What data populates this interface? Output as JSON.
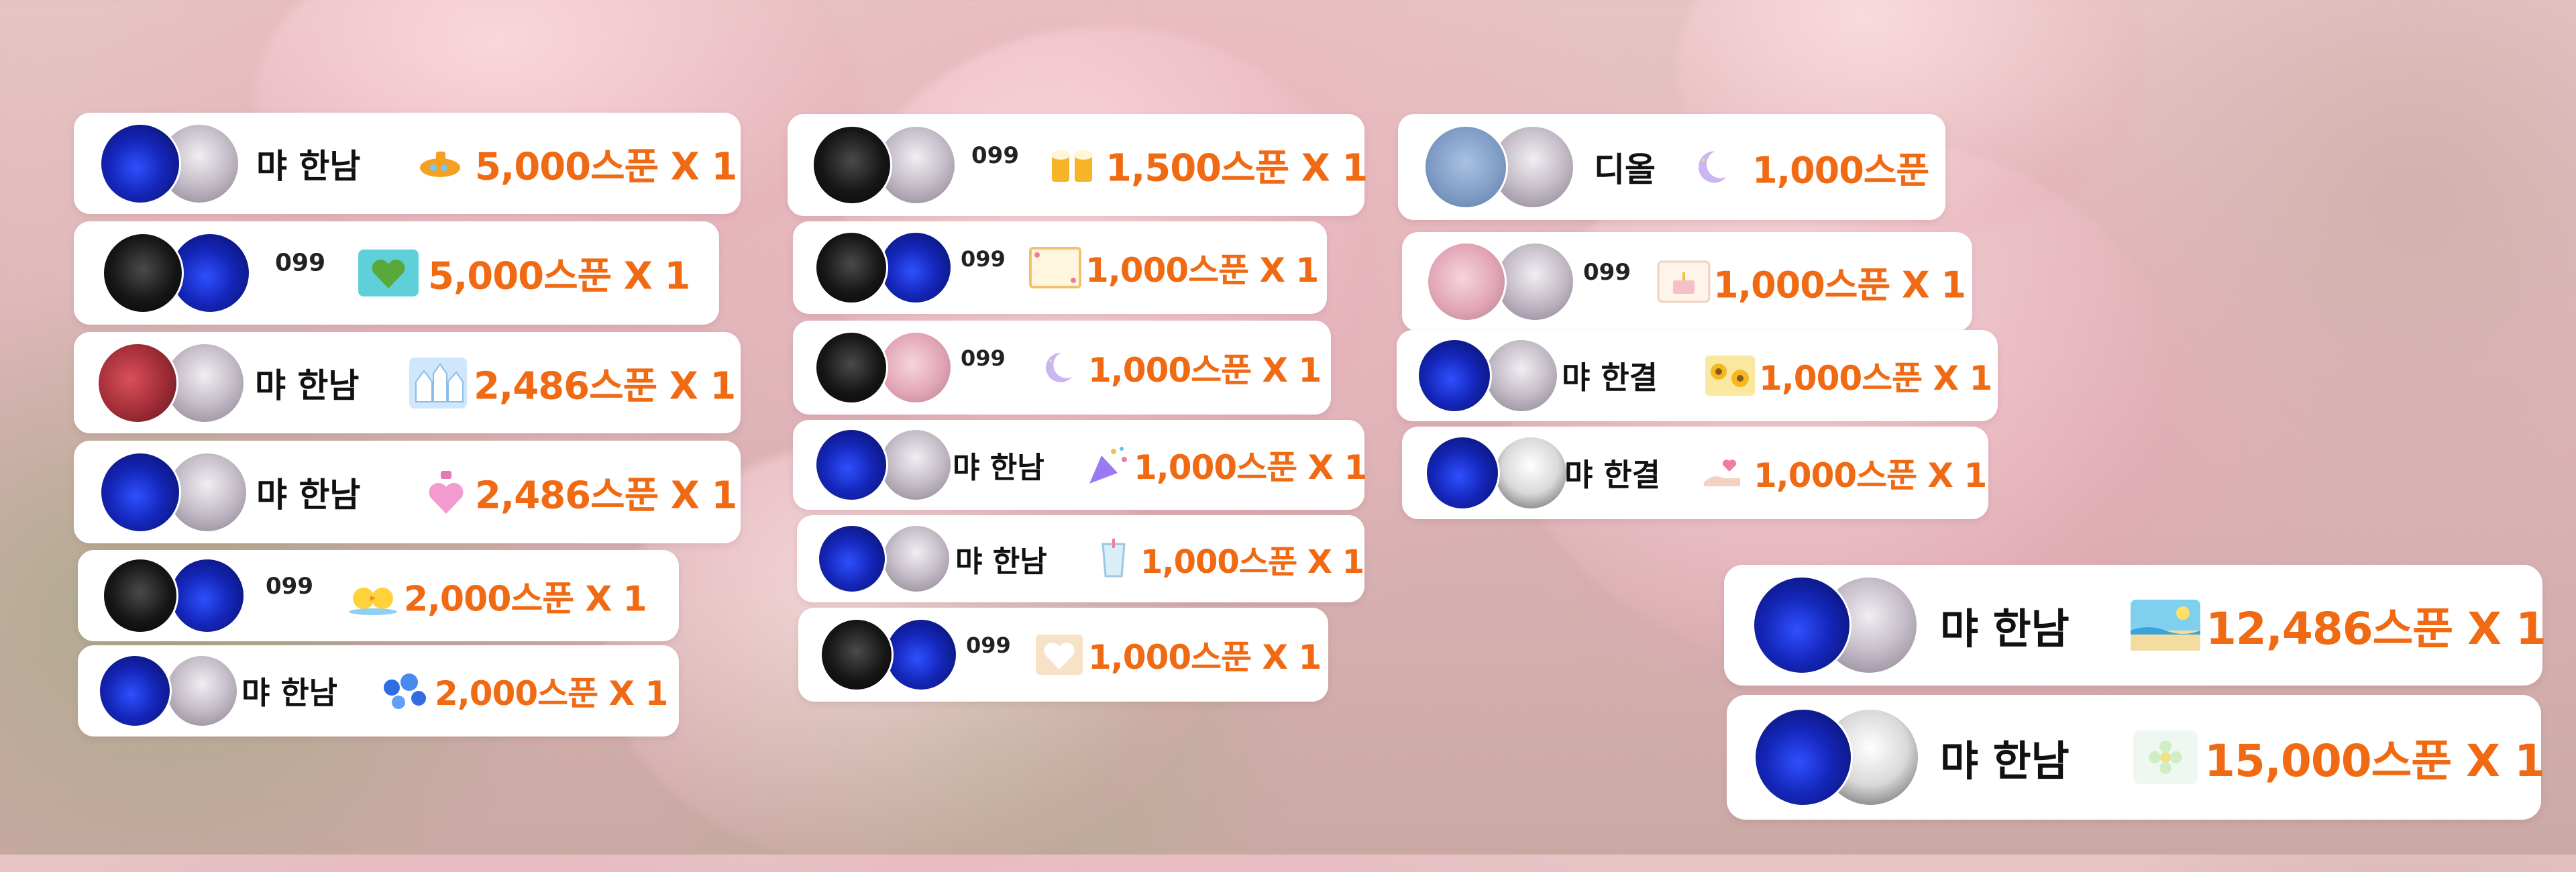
{
  "accent_color": "#f06a14",
  "cards": [
    {
      "name": "먀 한남",
      "gift_icon": "submarine-gift-icon",
      "amount": "5,000스푼 X 1"
    },
    {
      "name": "099",
      "gift_icon": "heart-island-gift-icon",
      "amount": "5,000스푼 X 1"
    },
    {
      "name": "먀 한남",
      "gift_icon": "ice-palace-gift-icon",
      "amount": "2,486스푼 X 1"
    },
    {
      "name": "먀 한남",
      "gift_icon": "perfume-bottle-gift-icon",
      "amount": "2,486스푼 X 1"
    },
    {
      "name": "099",
      "gift_icon": "ducks-gift-icon",
      "amount": "2,000스푼 X 1"
    },
    {
      "name": "먀 한남",
      "gift_icon": "blue-flowers-gift-icon",
      "amount": "2,000스푼 X 1"
    },
    {
      "name": "099",
      "gift_icon": "beer-cheers-gift-icon",
      "amount": "1,500스푼 X 1"
    },
    {
      "name": "099",
      "gift_icon": "letter-card-gift-icon",
      "amount": "1,000스푼 X 1"
    },
    {
      "name": "099",
      "gift_icon": "crescent-moon-gift-icon",
      "amount": "1,000스푼 X 1"
    },
    {
      "name": "먀 한남",
      "gift_icon": "party-popper-gift-icon",
      "amount": "1,000스푼 X 1"
    },
    {
      "name": "먀 한남",
      "gift_icon": "drink-cup-gift-icon",
      "amount": "1,000스푼 X 1"
    },
    {
      "name": "099",
      "gift_icon": "heart-frame-gift-icon",
      "amount": "1,000스푼 X 1"
    },
    {
      "name": "디올",
      "gift_icon": "crescent-moon-gift-icon",
      "amount": "1,000스푼"
    },
    {
      "name": "099",
      "gift_icon": "cake-card-gift-icon",
      "amount": "1,000스푼 X 1"
    },
    {
      "name": "먀 한결",
      "gift_icon": "sunflowers-gift-icon",
      "amount": "1,000스푼 X 1"
    },
    {
      "name": "먀 한결",
      "gift_icon": "hand-heart-gift-icon",
      "amount": "1,000스푼 X 1"
    },
    {
      "name": "먀 한남",
      "gift_icon": "beach-scene-gift-icon",
      "amount": "12,486스푼 X 1"
    },
    {
      "name": "먀 한남",
      "gift_icon": "sparkle-flower-gift-icon",
      "amount": "15,000스푼 X 1"
    }
  ]
}
